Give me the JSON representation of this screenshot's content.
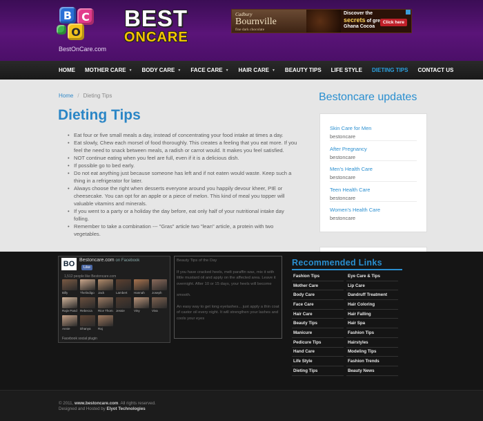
{
  "header": {
    "logo_letters": [
      "B",
      "C",
      "O"
    ],
    "logo_url": "BestOnCare.com",
    "brand_line1": "BEST",
    "brand_line2": "ONCARE",
    "ad": {
      "brand": "Cadbury",
      "product": "Bournville",
      "subtitle": "fine dark chocolate",
      "tagline_1": "Discover the",
      "tagline_2": "secrets",
      "tagline_3": "of great",
      "tagline_4": "Ghana Cocoa",
      "button": "Click here"
    }
  },
  "nav": {
    "items": [
      {
        "label": "HOME",
        "dropdown": false
      },
      {
        "label": "MOTHER CARE",
        "dropdown": true
      },
      {
        "label": "BODY CARE",
        "dropdown": true
      },
      {
        "label": "FACE CARE",
        "dropdown": true
      },
      {
        "label": "HAIR CARE",
        "dropdown": true
      },
      {
        "label": "BEAUTY TIPS",
        "dropdown": false
      },
      {
        "label": "LIFE STYLE",
        "dropdown": false
      },
      {
        "label": "DIETING TIPS",
        "dropdown": false,
        "active": true
      },
      {
        "label": "CONTACT US",
        "dropdown": false
      }
    ],
    "caret": "▼"
  },
  "breadcrumb": {
    "home": "Home",
    "separator": "/",
    "current": "Dieting Tips"
  },
  "main": {
    "title": "Dieting Tips",
    "tips": [
      "Eat four or five small meals a day, instead of concentrating your food intake at times a day.",
      "Eat slowly, Chew each morsel of food thoroughly. This creates a feeling that you eat more. If you feel the need to snack between meals, a radish or carrot would. It makes you feel satisfied.",
      "NOT continue eating when you feel are full, even if it is a delicious dish.",
      "If possible go to bed early.",
      "Do not eat anything just because someone has left and if not eaten would waste. Keep such a thing in a refrigerator for later.",
      "Always choose the right when desserts everyone around you happily devour kheer, PIE or cheesecake. You can opt for an apple or a piece of melon. This kind of meal you topper will valuable vitamins and minerals.",
      "If you went to a party or a holiday the day before, eat only half of your nutritional intake day folling.",
      "Remember to take a combination --- \"Gras\" article two \"lean\" article, a protein with two vegetables."
    ]
  },
  "sidebar": {
    "title": "Bestoncare updates",
    "items": [
      {
        "link": "Skin Care for Men",
        "author": "bestoncare"
      },
      {
        "link": "After Pregnancy",
        "author": "bestoncare"
      },
      {
        "link": "Men's Health Care",
        "author": "bestoncare"
      },
      {
        "link": "Teen Health Care",
        "author": "bestoncare"
      },
      {
        "link": "Women's Health Care",
        "author": "bestoncare"
      }
    ]
  },
  "facebook": {
    "logo": "BO",
    "page_name": "Bestoncare.com",
    "on_facebook": "on Facebook",
    "like_button": "Like",
    "count_text": "1,512 people like Bestoncare.com",
    "fans": [
      "Billy",
      "Thelindigo",
      "Jack",
      "Lambert",
      "Hannah",
      "Joseph",
      "Rajiv Pande",
      "Rebecca",
      "Rice Thomas",
      "Jessie",
      "Viny",
      "Viva",
      "Annie",
      "Dhanya",
      "Raj"
    ],
    "plugin": "Facebook social plugin"
  },
  "tip_of_day": {
    "lines": [
      "Beauty Tips of the Day",
      "If you have cracked heels, melt paraffin wax, mix it with little mustard oil and apply on the affected area. Leave it overnight. After 10 or 15 days, your heels will become",
      "smooth.",
      "An easy way to get long eyelashes... just apply a thin coat of castor oil every night. It will strengthen your lashes and cools your eyes"
    ]
  },
  "recommended": {
    "title": "Recommended Links",
    "links": [
      "Fashion Tips",
      "Eye Care & Tips",
      "Mother Care",
      "Lip Care",
      "Body Care",
      "Dandruff Treatment",
      "Face Care",
      "Hair Coloring",
      "Hair Care",
      "Hair Falling",
      "Beauty Tips",
      "Hair Spa",
      "Manicure",
      "Fashion Tips",
      "Pedicure Tips",
      "Hairstyles",
      "Hand Care",
      "Modeling Tips",
      "Life Style",
      "Fashion Trends",
      "Dieting Tips",
      "Beauty News"
    ]
  },
  "footer": {
    "copyright_prefix": "© 2011, ",
    "site": "www.bestoncare.com",
    "copyright_suffix": ". All rights reserved.",
    "designed_prefix": "Designed and Hosted by ",
    "designer": "Elyot Technologies"
  },
  "colors": {
    "header_purple": "#5a1478",
    "accent_blue": "#2a8fd0",
    "nav_active": "#2aa0de",
    "footer_dark": "#151515"
  }
}
